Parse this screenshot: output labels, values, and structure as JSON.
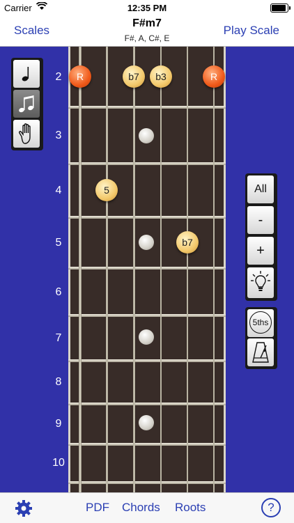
{
  "status": {
    "carrier": "Carrier",
    "time": "12:35 PM"
  },
  "nav": {
    "left_label": "Scales",
    "title": "F#m7",
    "subtitle": "F#, A, C#, E",
    "right_label": "Play Scale"
  },
  "fret_numbers": [
    "2",
    "3",
    "4",
    "5",
    "6",
    "7",
    "8",
    "9",
    "10"
  ],
  "notes": {
    "root": "R",
    "flat7": "b7",
    "flat3": "b3",
    "fifth": "5"
  },
  "side_buttons": {
    "all": "All",
    "minus": "-",
    "plus": "+",
    "fifths": "5ths"
  },
  "toolbar": {
    "pdf": "PDF",
    "chords": "Chords",
    "roots": "Roots",
    "help": "?"
  },
  "colors": {
    "fretboard_bg": "#3131a8",
    "accent": "#2b3fb3",
    "root_note": "#f05a1a",
    "chord_tone": "#f3c96c"
  },
  "icons": {
    "single_note": "quarter-note-icon",
    "double_note": "beamed-notes-icon",
    "hand": "hand-icon",
    "bulb": "lightbulb-icon",
    "metronome": "metronome-icon",
    "gear": "gear-icon"
  }
}
